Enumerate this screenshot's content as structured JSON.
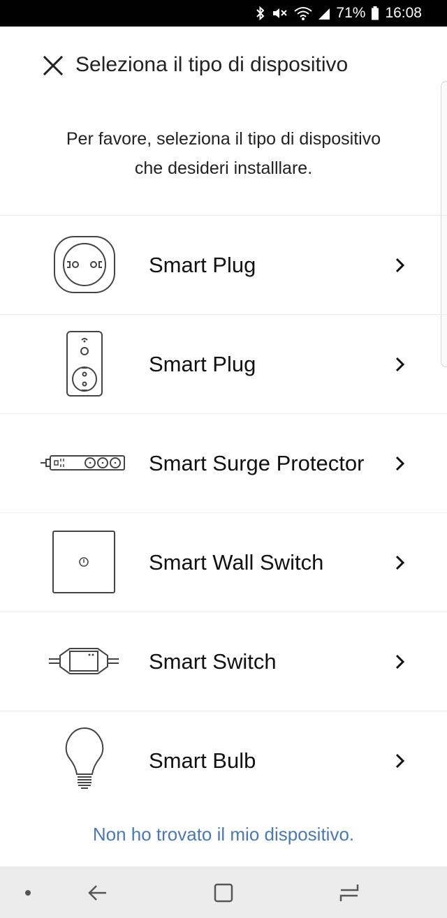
{
  "status_bar": {
    "battery_percent": "71%",
    "time": "16:08"
  },
  "header": {
    "title": "Seleziona il tipo di dispositivo"
  },
  "intro": {
    "line1": "Per favore, seleziona il tipo di dispositivo",
    "line2": "che desideri installlare."
  },
  "devices": [
    {
      "label": "Smart Plug",
      "icon": "round-plug-icon"
    },
    {
      "label": "Smart Plug",
      "icon": "wall-plug-icon"
    },
    {
      "label": "Smart Surge Protector",
      "icon": "power-strip-icon"
    },
    {
      "label": "Smart Wall Switch",
      "icon": "wall-switch-icon"
    },
    {
      "label": "Smart Switch",
      "icon": "inline-switch-icon"
    },
    {
      "label": "Smart Bulb",
      "icon": "bulb-icon"
    }
  ],
  "not_found_link": "Non ho trovato il mio dispositivo.",
  "colors": {
    "link": "#4a79b8",
    "status_bar_bg": "#000000",
    "nav_bar_bg": "#ececec"
  }
}
